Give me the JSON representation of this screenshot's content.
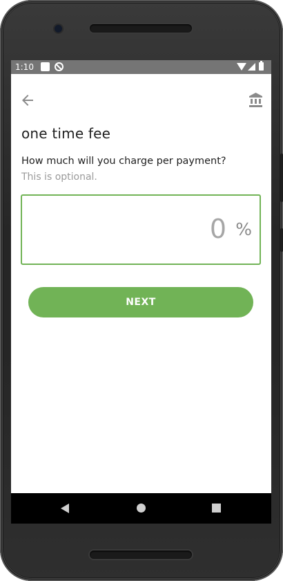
{
  "status_bar": {
    "time": "1:10"
  },
  "toolbar": {
    "back_icon": "arrow-left-icon",
    "action_icon": "bank-icon"
  },
  "content": {
    "title": "one time fee",
    "question": "How much will you charge per payment?",
    "hint": "This is optional.",
    "fee_input": {
      "value": "0",
      "unit": "%"
    },
    "next_label": "NEXT"
  },
  "nav_bar": {
    "icons": [
      "back-triangle-icon",
      "home-circle-icon",
      "recents-square-icon"
    ]
  },
  "colors": {
    "accent": "#71b356",
    "status_bar": "#757575",
    "nav_bar": "#000000"
  }
}
